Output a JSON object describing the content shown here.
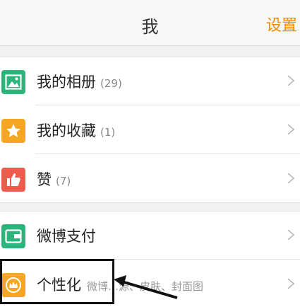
{
  "header": {
    "title": "我",
    "settings_label": "设置"
  },
  "colors": {
    "accent": "#f08a00",
    "album_icon_bg": "#2db47d",
    "favorites_icon_bg": "#f5a623",
    "likes_icon_bg": "#ef5b4d",
    "pay_icon_bg": "#2db47d",
    "personalize_icon_bg": "#f5a623"
  },
  "menu": {
    "album": {
      "label": "我的相册",
      "count": "(29)",
      "icon": "photo-icon"
    },
    "favorites": {
      "label": "我的收藏",
      "count": "(1)",
      "icon": "star-icon"
    },
    "likes": {
      "label": "赞",
      "count": "(7)",
      "icon": "thumbs-up-icon"
    },
    "pay": {
      "label": "微博支付",
      "icon": "wallet-icon"
    },
    "personalize": {
      "label": "个性化",
      "sub": "微博…源、皮肤、封面图",
      "icon": "crown-icon"
    }
  }
}
